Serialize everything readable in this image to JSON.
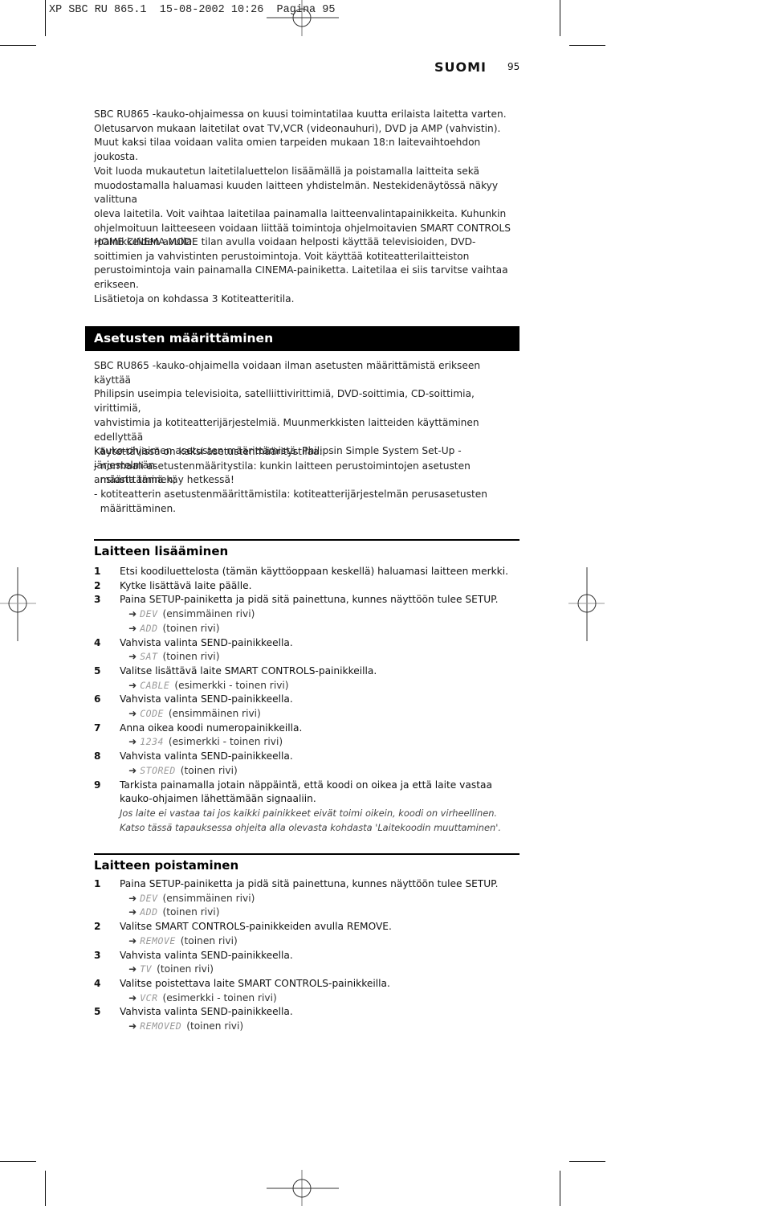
{
  "slug": "XP SBC RU 865.1  15-08-2002 10:26  Pagina 95",
  "header": {
    "language": "SUOMI",
    "page_number": "95"
  },
  "intro": {
    "paragraph1": [
      "SBC RU865 -kauko-ohjaimessa on kuusi toimintatilaa kuutta erilaista laitetta varten.",
      "Oletusarvon mukaan laitetilat ovat TV,VCR (videonauhuri), DVD ja AMP (vahvistin).",
      "Muut kaksi tilaa voidaan valita omien tarpeiden mukaan 18:n laitevaihtoehdon joukosta.",
      "Voit luoda mukautetun laitetilaluettelon lisäämällä ja poistamalla laitteita sekä",
      "muodostamalla haluamasi kuuden laitteen yhdistelmän. Nestekidenäytössä näkyy valittuna",
      "oleva laitetila. Voit vaihtaa laitetilaa painamalla laitteenvalintapainikkeita. Kuhunkin",
      "ohjelmoituun laitteeseen voidaan liittää toimintoja ohjelmoitavien SMART CONTROLS",
      "-painikkeiden avulla."
    ],
    "paragraph2": [
      "HOME CINEMA MODE tilan avulla voidaan helposti käyttää televisioiden, DVD-",
      "soittimien ja vahvistinten perustoimintoja. Voit käyttää kotiteatterilaitteiston",
      "perustoimintoja vain painamalla CINEMA-painiketta. Laitetilaa ei siis tarvitse vaihtaa",
      "erikseen.",
      "Lisätietoja on kohdassa 3 Kotiteatteritila."
    ]
  },
  "section_setup": {
    "title": "Asetusten määrittäminen",
    "paragraph1": [
      "SBC RU865 -kauko-ohjaimella voidaan ilman asetusten määrittämistä erikseen käyttää",
      "Philipsin useimpia televisioita, satelliittivirittimiä, DVD-soittimia, CD-soittimia, virittimiä,",
      "vahvistimia ja kotiteatterijärjestelmiä. Muunmerkkisten laitteiden käyttäminen edellyttää",
      "kauko-ohjaimen asetusten määrittämistä. Philipsin Simple System Set-Up -järjestelmän",
      "ansiosta tämä käy hetkessä!"
    ],
    "paragraph2": [
      "Käytettävissä on kaksi asetustenmääritystilaa:",
      "- normaali asetustenmääritystila: kunkin laitteen perustoimintojen asetusten",
      "  määrittäminen;",
      "- kotiteatterin asetustenmäärittämistila: kotiteatterijärjestelmän perusasetusten",
      "  määrittäminen."
    ]
  },
  "section_add": {
    "title": "Laitteen lisääminen",
    "steps": [
      {
        "n": "1",
        "text": "Etsi koodiluettelosta (tämän käyttöoppaan keskellä) haluamasi laitteen merkki.",
        "results": []
      },
      {
        "n": "2",
        "text": "Kytke lisättävä laite päälle.",
        "results": []
      },
      {
        "n": "3",
        "text": "Paina SETUP-painiketta ja pidä sitä painettuna, kunnes näyttöön tulee SETUP.",
        "results": [
          {
            "lcd": "DEV",
            "note": "(ensimmäinen rivi)"
          },
          {
            "lcd": "ADD",
            "note": "(toinen rivi)"
          }
        ]
      },
      {
        "n": "4",
        "text": "Vahvista valinta SEND-painikkeella.",
        "results": [
          {
            "lcd": "SAT",
            "note": "(toinen rivi)"
          }
        ]
      },
      {
        "n": "5",
        "text": "Valitse lisättävä laite SMART CONTROLS-painikkeilla.",
        "results": [
          {
            "lcd": "CABLE",
            "note": "(esimerkki - toinen rivi)"
          }
        ]
      },
      {
        "n": "6",
        "text": "Vahvista valinta SEND-painikkeella.",
        "results": [
          {
            "lcd": "CODE",
            "note": "(ensimmäinen rivi)"
          }
        ]
      },
      {
        "n": "7",
        "text": "Anna oikea koodi numeropainikkeilla.",
        "results": [
          {
            "lcd": "1234",
            "note": "(esimerkki - toinen rivi)"
          }
        ]
      },
      {
        "n": "8",
        "text": "Vahvista valinta SEND-painikkeella.",
        "results": [
          {
            "lcd": "STORED",
            "note": "(toinen rivi)"
          }
        ]
      },
      {
        "n": "9",
        "text": "Tarkista painamalla jotain näppäintä, että koodi on oikea ja että laite vastaa kauko-ohjaimen lähettämään signaaliin.",
        "results": []
      }
    ],
    "note": [
      "Jos laite ei vastaa tai jos kaikki painikkeet eivät toimi oikein, koodi on virheellinen.",
      "Katso tässä tapauksessa ohjeita alla olevasta kohdasta 'Laitekoodin muuttaminen'."
    ]
  },
  "section_remove": {
    "title": "Laitteen poistaminen",
    "steps": [
      {
        "n": "1",
        "text": "Paina SETUP-painiketta ja pidä sitä painettuna, kunnes näyttöön tulee SETUP.",
        "results": [
          {
            "lcd": "DEV",
            "note": "(ensimmäinen rivi)"
          },
          {
            "lcd": "ADD",
            "note": "(toinen rivi)"
          }
        ]
      },
      {
        "n": "2",
        "text": "Valitse SMART CONTROLS-painikkeiden avulla REMOVE.",
        "results": [
          {
            "lcd": "REMOVE",
            "note": "(toinen rivi)"
          }
        ]
      },
      {
        "n": "3",
        "text": "Vahvista valinta SEND-painikkeella.",
        "results": [
          {
            "lcd": "TV",
            "note": "(toinen rivi)"
          }
        ]
      },
      {
        "n": "4",
        "text": "Valitse poistettava laite SMART CONTROLS-painikkeilla.",
        "results": [
          {
            "lcd": "VCR",
            "note": "(esimerkki - toinen rivi)"
          }
        ]
      },
      {
        "n": "5",
        "text": "Vahvista valinta SEND-painikkeella.",
        "results": [
          {
            "lcd": "REMOVED",
            "note": "(toinen rivi)"
          }
        ]
      }
    ]
  },
  "arrow_glyph": "➜"
}
